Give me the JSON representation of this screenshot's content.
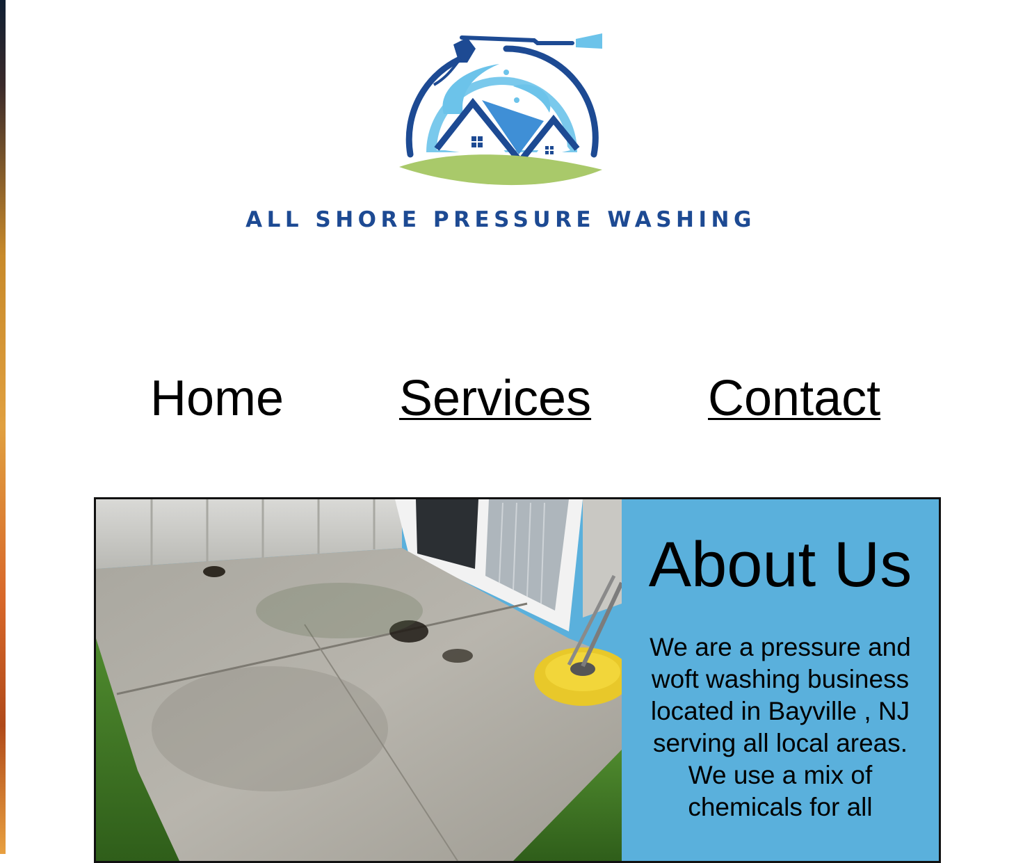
{
  "brand": {
    "name": "ALL SHORE PRESSURE WASHING",
    "colors": {
      "navy": "#1d4a93",
      "sky": "#5ab0dc",
      "light_blue": "#6cc3ea",
      "grass": "#a9c96a"
    }
  },
  "nav": {
    "items": [
      {
        "label": "Home"
      },
      {
        "label": "Services"
      },
      {
        "label": "Contact"
      }
    ]
  },
  "about": {
    "title": "About Us",
    "body": "We are a pressure and woft washing business located in Bayville , NJ serving all local areas. We use a mix of chemicals for all",
    "background": "#5ab0dc"
  },
  "photo": {
    "icon": "patio-cleaning-photo"
  }
}
